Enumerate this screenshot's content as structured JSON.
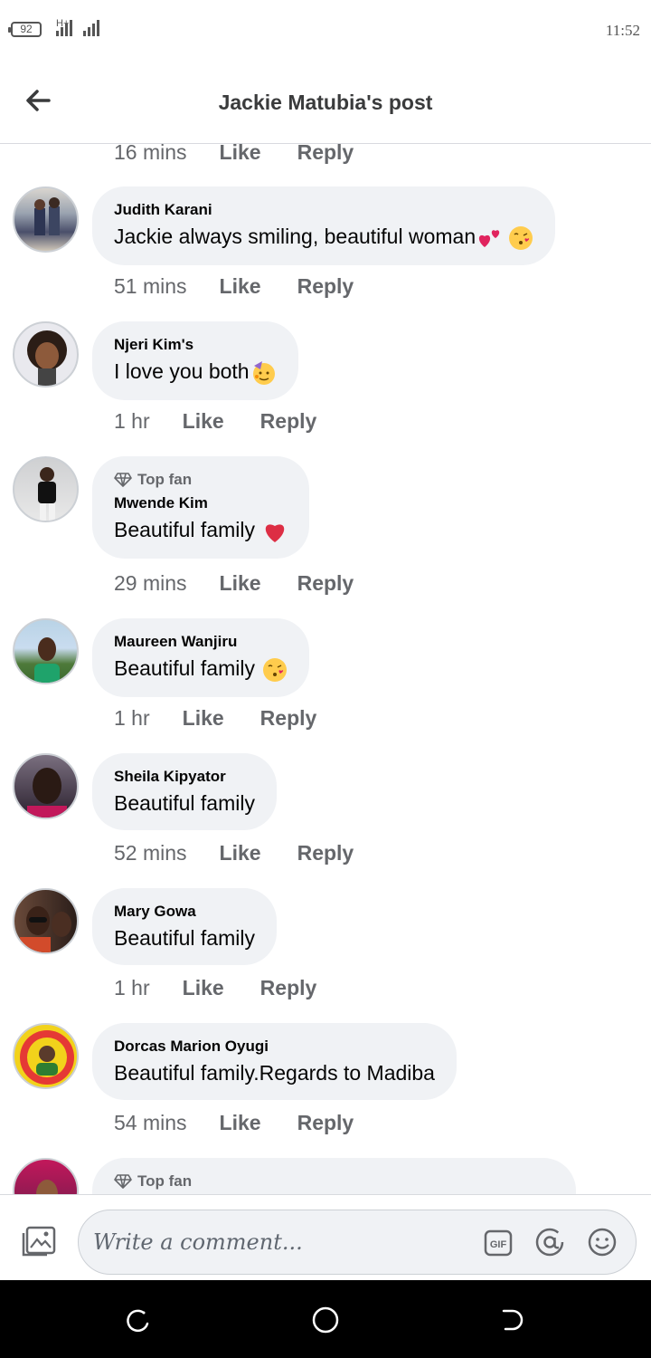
{
  "status_bar": {
    "battery": "92",
    "network": "H+",
    "time": "11:52"
  },
  "header": {
    "title": "Jackie Matubia's post",
    "back_icon": "arrow-left-icon"
  },
  "top_meta": {
    "time": "16 mins",
    "like": "Like",
    "reply": "Reply"
  },
  "comments": [
    {
      "name": "Judith Karani",
      "text": "Jackie always smiling, beautiful woman",
      "emoji": [
        "hearts",
        "kiss-face"
      ],
      "time": "51 mins",
      "like": "Like",
      "reply": "Reply",
      "top_fan": ""
    },
    {
      "name": "Njeri Kim's",
      "text": "I love you both",
      "emoji": [
        "party-face"
      ],
      "time": "1 hr",
      "like": "Like",
      "reply": "Reply",
      "top_fan": ""
    },
    {
      "name": "Mwende Kim",
      "text": "Beautiful family ",
      "emoji": [
        "red-heart"
      ],
      "time": "29 mins",
      "like": "Like",
      "reply": "Reply",
      "top_fan": "Top fan"
    },
    {
      "name": "Maureen Wanjiru",
      "text": "Beautiful family ",
      "emoji": [
        "kiss-face"
      ],
      "time": "1 hr",
      "like": "Like",
      "reply": "Reply",
      "top_fan": ""
    },
    {
      "name": "Sheila Kipyator",
      "text": "Beautiful family",
      "emoji": [],
      "time": "52 mins",
      "like": "Like",
      "reply": "Reply",
      "top_fan": ""
    },
    {
      "name": "Mary Gowa",
      "text": "Beautiful family",
      "emoji": [],
      "time": "1 hr",
      "like": "Like",
      "reply": "Reply",
      "top_fan": ""
    },
    {
      "name": "Dorcas Marion Oyugi",
      "text": "Beautiful family.Regards to Madiba",
      "emoji": [],
      "time": "54 mins",
      "like": "Like",
      "reply": "Reply",
      "top_fan": ""
    },
    {
      "name": "",
      "text": "",
      "emoji": [],
      "time": "",
      "like": "",
      "reply": "",
      "top_fan": "Top fan"
    }
  ],
  "composer": {
    "placeholder": "Write a comment...",
    "icons": [
      "photo-icon",
      "gif-icon",
      "at-icon",
      "emoji-icon"
    ]
  },
  "colors": {
    "bubble": "#f0f2f5",
    "meta_text": "#65676b",
    "heart": "#e0245e",
    "emoji_yellow": "#ffcc4d"
  }
}
